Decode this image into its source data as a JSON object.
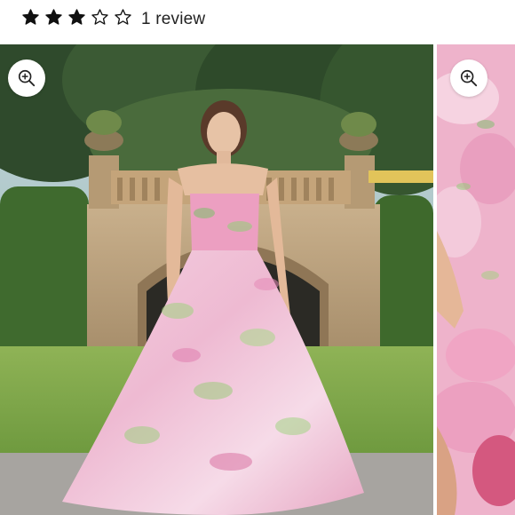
{
  "rating": {
    "value": 3,
    "max": 5,
    "review_label": "1 review",
    "star_color": "#111111"
  },
  "gallery": {
    "current_image_alt": "",
    "zoom_icon": "zoom-in-icon"
  }
}
